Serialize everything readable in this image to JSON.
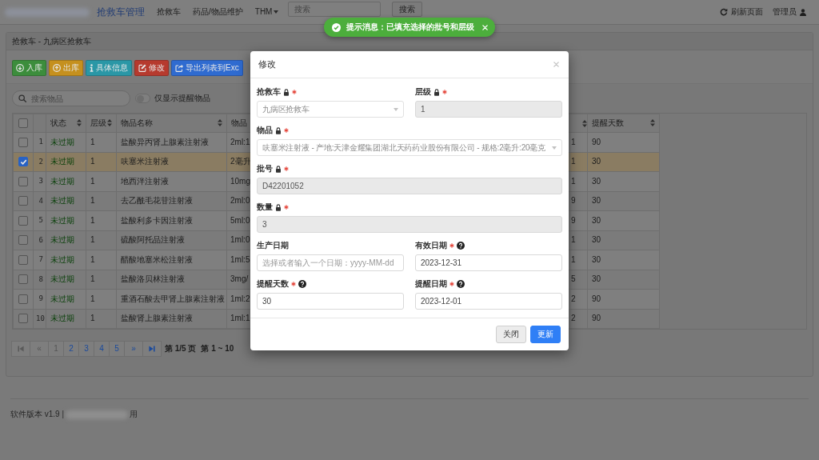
{
  "navbar": {
    "brand": "抢救车管理",
    "links": [
      {
        "label": "抢救车",
        "dropdown": false
      },
      {
        "label": "药品/物品维护",
        "dropdown": false
      },
      {
        "label": "THM",
        "dropdown": true
      }
    ],
    "search": {
      "placeholder": "搜索",
      "button": "搜索"
    },
    "refresh": "刷新页面",
    "user": "管理员"
  },
  "toast": {
    "kind": "success",
    "message": "提示消息：已填充选择的批号和层级"
  },
  "panel": {
    "title": "抢救车 - 九病区抢救车",
    "toolbar": [
      {
        "label": "入库",
        "kind": "success"
      },
      {
        "label": "出库",
        "kind": "warning"
      },
      {
        "label": "具体信息",
        "kind": "info"
      },
      {
        "label": "修改",
        "kind": "danger"
      },
      {
        "label": "导出列表到Exc",
        "kind": "primary"
      }
    ],
    "search": {
      "placeholder": "搜索物品"
    },
    "reminder_toggle": {
      "label": "仅显示提醒物品",
      "on": false
    }
  },
  "table": {
    "select_all": {
      "checked": false
    },
    "columns": [
      {
        "label": "状态",
        "sortable": true
      },
      {
        "label": "层级",
        "sortable": true
      },
      {
        "label": "物品名称",
        "sortable": true
      },
      {
        "label": "物品",
        "sortable": false
      },
      {
        "sortable": true
      },
      {
        "label": "提醒天数",
        "sortable": true
      }
    ],
    "rows": [
      {
        "number": "1",
        "checked": false,
        "cells": [
          "未过期",
          "1",
          "盐酸异丙肾上腺素注射液",
          "2ml:1",
          "1",
          "90"
        ]
      },
      {
        "number": "2",
        "checked": true,
        "cells": [
          "未过期",
          "1",
          "呋塞米注射液",
          "2毫升",
          "1",
          "30"
        ]
      },
      {
        "number": "3",
        "checked": false,
        "cells": [
          "未过期",
          "1",
          "地西泮注射液",
          "10mg",
          "1",
          "30"
        ]
      },
      {
        "number": "4",
        "checked": false,
        "cells": [
          "未过期",
          "1",
          "去乙酰毛花苷注射液",
          "2ml:0",
          "9",
          "30"
        ]
      },
      {
        "number": "5",
        "checked": false,
        "cells": [
          "未过期",
          "1",
          "盐酸利多卡因注射液",
          "5ml:0",
          "9",
          "30"
        ]
      },
      {
        "number": "6",
        "checked": false,
        "cells": [
          "未过期",
          "1",
          "硫酸阿托品注射液",
          "1ml:0",
          "1",
          "30"
        ]
      },
      {
        "number": "7",
        "checked": false,
        "cells": [
          "未过期",
          "1",
          "醋酸地塞米松注射液",
          "1ml:5",
          "1",
          "30"
        ]
      },
      {
        "number": "8",
        "checked": false,
        "cells": [
          "未过期",
          "1",
          "盐酸洛贝林注射液",
          "3mg/",
          "5",
          "30"
        ]
      },
      {
        "number": "9",
        "checked": false,
        "cells": [
          "未过期",
          "1",
          "重酒石酸去甲肾上腺素注射液",
          "1ml:2",
          "2",
          "90"
        ]
      },
      {
        "number": "10",
        "checked": false,
        "cells": [
          "未过期",
          "1",
          "盐酸肾上腺素注射液",
          "1ml:1",
          "2",
          "90"
        ]
      }
    ]
  },
  "pagination": {
    "first": {
      "disabled": true
    },
    "prev": {
      "label": "«",
      "disabled": true
    },
    "pages": [
      {
        "label": "1",
        "selected": true
      },
      {
        "label": "2",
        "selected": false
      },
      {
        "label": "3",
        "selected": false
      },
      {
        "label": "4",
        "selected": false
      },
      {
        "label": "5",
        "selected": false
      }
    ],
    "next": {
      "label": "»",
      "disabled": false
    },
    "last": {
      "disabled": false
    },
    "page_info": "第 1/5 页",
    "range_info": "第 1 ~ 10"
  },
  "footer": {
    "version": "软件版本 v1.9 |",
    "suffix": "用"
  },
  "modal": {
    "title": "修改",
    "rows": [
      {
        "fields": [
          {
            "label": "抢救车",
            "kind": "select",
            "value": "九病区抢救车",
            "locked": true,
            "required": true,
            "help": false,
            "disabled": true
          },
          {
            "label": "层级",
            "kind": "input",
            "value": "1",
            "locked": true,
            "required": true,
            "help": false,
            "disabled": true
          }
        ]
      },
      {
        "fields": [
          {
            "label": "物品",
            "kind": "select",
            "value": "呋塞米注射液 - 产地:天津金耀集团湖北天药药业股份有限公司 - 规格:2毫升:20毫克",
            "locked": true,
            "required": true,
            "help": false,
            "disabled": true
          }
        ]
      },
      {
        "fields": [
          {
            "label": "批号",
            "kind": "input",
            "value": "D42201052",
            "locked": true,
            "required": true,
            "help": false,
            "disabled": true
          }
        ]
      },
      {
        "fields": [
          {
            "label": "数量",
            "kind": "input",
            "value": "3",
            "locked": true,
            "required": true,
            "help": false,
            "disabled": true
          }
        ]
      },
      {
        "fields": [
          {
            "label": "生产日期",
            "kind": "input",
            "placeholder": "选择或者输入一个日期：yyyy-MM-dd",
            "locked": false,
            "required": false,
            "help": false,
            "disabled": false
          },
          {
            "label": "有效日期",
            "kind": "input",
            "value": "2023-12-31",
            "locked": false,
            "required": true,
            "help": true,
            "disabled": false
          }
        ]
      },
      {
        "fields": [
          {
            "label": "提醒天数",
            "kind": "input",
            "value": "30",
            "locked": false,
            "required": true,
            "help": true,
            "disabled": false
          },
          {
            "label": "提醒日期",
            "kind": "input",
            "value": "2023-12-01",
            "locked": false,
            "required": true,
            "help": true,
            "disabled": false
          }
        ]
      }
    ],
    "buttons": [
      {
        "label": "关闭",
        "kind": "secondary"
      },
      {
        "label": "更新",
        "kind": "primary"
      }
    ]
  }
}
